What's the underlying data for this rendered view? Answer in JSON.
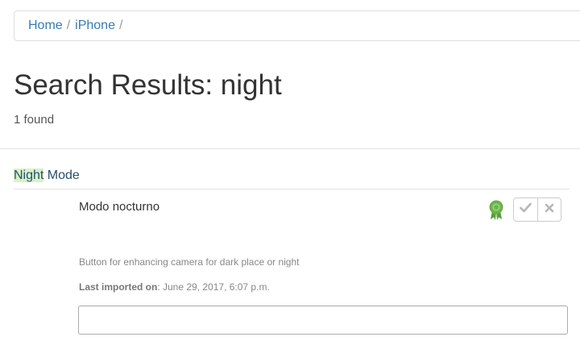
{
  "breadcrumb": {
    "items": [
      {
        "label": "Home"
      },
      {
        "label": "iPhone"
      }
    ],
    "separator": "/"
  },
  "search": {
    "title": "Search Results: night",
    "count_text": "1 found"
  },
  "result": {
    "title_highlight": "Night",
    "title_rest": " Mode",
    "translation": "Modo nocturno",
    "description": "Button for enhancing camera for dark place or night",
    "imported_label": "Last imported on",
    "imported_value": ": June 29, 2017, 6:07 p.m.",
    "input_value": "",
    "icons": {
      "award": "award-icon",
      "approve": "check-icon",
      "reject": "close-icon"
    },
    "colors": {
      "award": "#6ab04c",
      "highlight": "#d8f2c8",
      "link": "#337ab7"
    }
  }
}
